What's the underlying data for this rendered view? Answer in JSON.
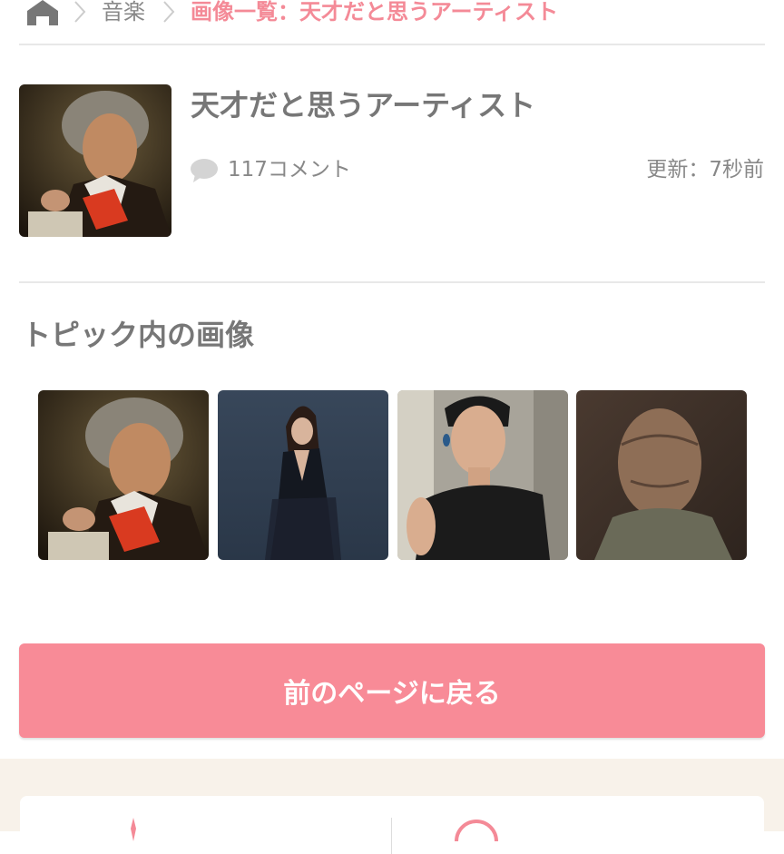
{
  "breadcrumb": {
    "category": "音楽",
    "current": "画像一覧：天才だと思うアーティスト"
  },
  "topic": {
    "title": "天才だと思うアーティスト",
    "comment_count": "117コメント",
    "updated": "更新：7秒前"
  },
  "gallery": {
    "heading": "トピック内の画像"
  },
  "back_button": {
    "label": "前のページに戻る"
  },
  "footer": {
    "left_label": "",
    "right_label": ""
  },
  "colors": {
    "accent": "#f48a97",
    "button": "#f88b97",
    "footer_bg": "#f8f2ea"
  }
}
